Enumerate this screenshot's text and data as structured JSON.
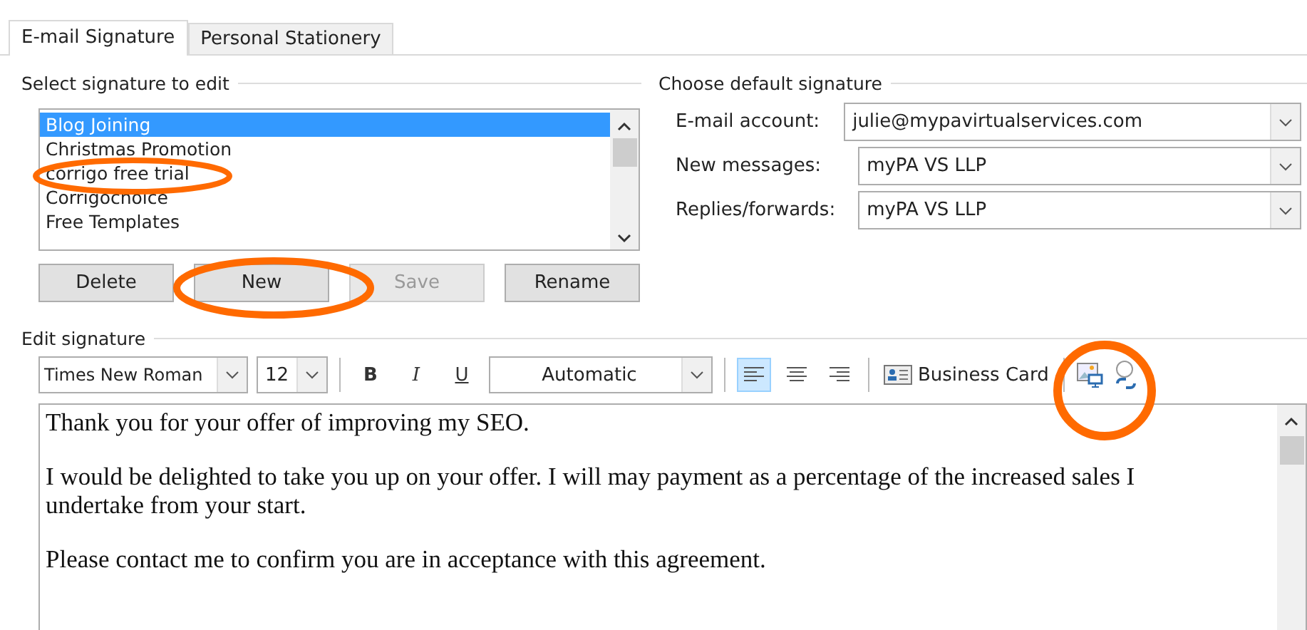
{
  "tabs": [
    {
      "label": "E-mail Signature",
      "selected": true
    },
    {
      "label": "Personal Stationery",
      "selected": false
    }
  ],
  "select_signature": {
    "heading": "Select signature to edit",
    "items": [
      {
        "label": "Blog Joining",
        "selected": true
      },
      {
        "label": "Christmas Promotion",
        "selected": false
      },
      {
        "label": "corrigo free trial",
        "selected": false
      },
      {
        "label": "Corrigochoice",
        "selected": false
      },
      {
        "label": "Free Templates",
        "selected": false
      }
    ],
    "buttons": [
      {
        "label": "Delete",
        "disabled": false
      },
      {
        "label": "New",
        "disabled": false
      },
      {
        "label": "Save",
        "disabled": true
      },
      {
        "label": "Rename",
        "disabled": false
      }
    ]
  },
  "default_signature": {
    "heading": "Choose default signature",
    "fields": [
      {
        "label": "E-mail account:",
        "value": "julie@mypavirtualservices.com"
      },
      {
        "label": "New messages:",
        "value": "myPA VS LLP"
      },
      {
        "label": "Replies/forwards:",
        "value": "myPA VS LLP"
      }
    ]
  },
  "edit_signature": {
    "heading": "Edit signature",
    "font": "Times New Roman",
    "size": "12",
    "bold": "B",
    "italic": "I",
    "underline": "U",
    "font_color": "Automatic",
    "business_card": "Business Card",
    "paragraphs": [
      "Thank you for your offer of improving my SEO.",
      "I would be delighted to take you up on your offer.  I will may payment as a percentage of the increased sales I undertake from your start.",
      "Please contact me to confirm you are in acceptance with this agreement."
    ]
  }
}
